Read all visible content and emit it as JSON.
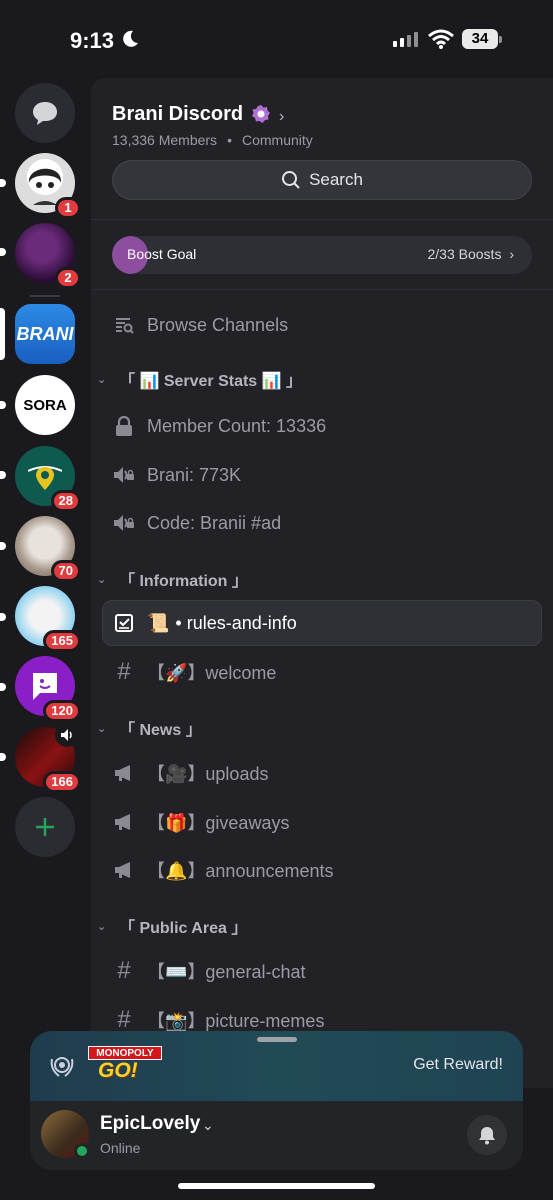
{
  "status_bar": {
    "time": "9:13",
    "battery": "34"
  },
  "rail": {
    "servers": [
      {
        "name": "dm",
        "badge": ""
      },
      {
        "name": "server-avatar-1",
        "badge": "1"
      },
      {
        "name": "server-avatar-2",
        "badge": "2"
      },
      {
        "name": "brani",
        "label": "BRANI",
        "badge": ""
      },
      {
        "name": "sora",
        "label": "SORA",
        "badge": ""
      },
      {
        "name": "server-location",
        "badge": "28"
      },
      {
        "name": "server-avatar-6",
        "badge": "70"
      },
      {
        "name": "server-avatar-7",
        "badge": "165"
      },
      {
        "name": "server-avatar-8",
        "badge": "120"
      },
      {
        "name": "server-avatar-9",
        "badge": "166"
      }
    ]
  },
  "server": {
    "name": "Brani Discord",
    "members": "13,336 Members",
    "type": "Community",
    "search_label": "Search",
    "boost_label": "Boost Goal",
    "boost_count": "2/33 Boosts",
    "boost_progress": 0.0606
  },
  "channels": {
    "browse": "Browse Channels",
    "cat_stats": "「 📊 Server Stats 📊 」",
    "member_count": "Member Count: 13336",
    "brani_count": "Brani: 773K",
    "code": "Code: Branii #ad",
    "cat_info": "「 Information 」",
    "rules": "• rules-and-info",
    "rules_emoji": "📜",
    "welcome": "【🚀】welcome",
    "cat_news": "「 News 」",
    "uploads": "【🎥】uploads",
    "giveaways": "【🎁】giveaways",
    "announcements": "【🔔】announcements",
    "cat_public": "「 Public Area 」",
    "general": "【⌨️】general-chat",
    "pictures": "【📸】picture-memes"
  },
  "ad": {
    "brand_top": "MONOPOLY",
    "brand_bottom": "GO!",
    "cta": "Get Reward!"
  },
  "user": {
    "name": "EpicLovely",
    "status": "Online"
  },
  "colors": {
    "accent": "#8d4ea0",
    "badge": "#e03b3f",
    "online": "#23a55a"
  }
}
